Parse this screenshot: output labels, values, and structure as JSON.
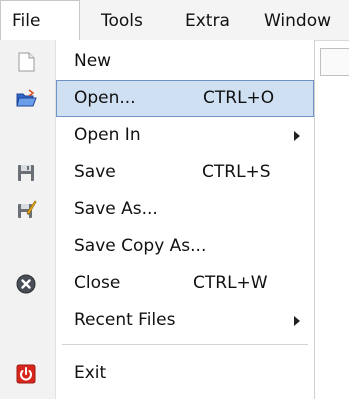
{
  "menubar": {
    "items": [
      "File",
      "Tools",
      "Extra",
      "Window"
    ]
  },
  "menu": {
    "items": [
      {
        "label": "New",
        "shortcut": "",
        "icon": "new-file-icon",
        "submenu": false
      },
      {
        "label": "Open...",
        "shortcut": "CTRL+O",
        "icon": "open-folder-icon",
        "submenu": false,
        "highlighted": true
      },
      {
        "label": "Open In",
        "shortcut": "",
        "icon": "",
        "submenu": true
      },
      {
        "label": "Save",
        "shortcut": "CTRL+S",
        "icon": "floppy-disk-icon",
        "submenu": false
      },
      {
        "label": "Save As...",
        "shortcut": "",
        "icon": "save-as-icon",
        "submenu": false
      },
      {
        "label": "Save Copy As...",
        "shortcut": "",
        "icon": "",
        "submenu": false
      },
      {
        "label": "Close",
        "shortcut": "CTRL+W",
        "icon": "close-circle-icon",
        "submenu": false
      },
      {
        "label": "Recent Files",
        "shortcut": "",
        "icon": "",
        "submenu": true
      },
      {
        "label": "Exit",
        "shortcut": "",
        "icon": "power-icon",
        "submenu": false
      }
    ]
  },
  "colors": {
    "highlight_bg": "#cfe0f3",
    "highlight_border": "#6f93c3",
    "icon_strip": "#f2f2f2",
    "close_icon": "#4a4f57",
    "exit_icon": "#d9261c"
  }
}
